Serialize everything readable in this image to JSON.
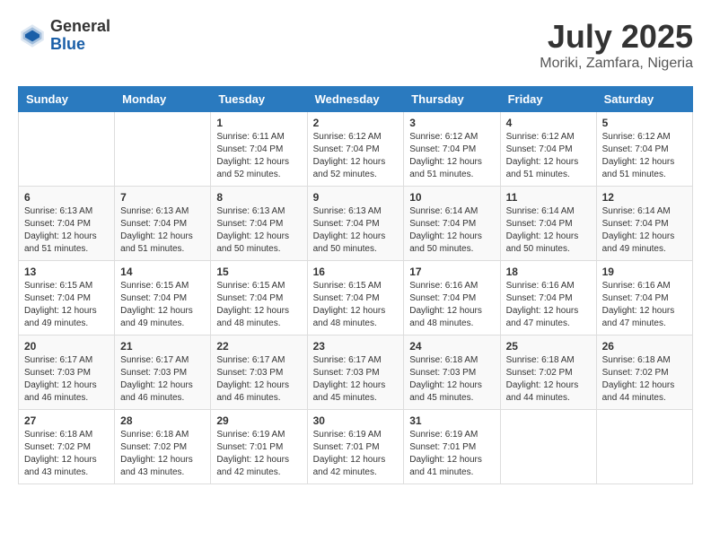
{
  "logo": {
    "general": "General",
    "blue": "Blue"
  },
  "title": {
    "month_year": "July 2025",
    "location": "Moriki, Zamfara, Nigeria"
  },
  "weekdays": [
    "Sunday",
    "Monday",
    "Tuesday",
    "Wednesday",
    "Thursday",
    "Friday",
    "Saturday"
  ],
  "weeks": [
    [
      {
        "day": "",
        "info": ""
      },
      {
        "day": "",
        "info": ""
      },
      {
        "day": "1",
        "info": "Sunrise: 6:11 AM\nSunset: 7:04 PM\nDaylight: 12 hours and 52 minutes."
      },
      {
        "day": "2",
        "info": "Sunrise: 6:12 AM\nSunset: 7:04 PM\nDaylight: 12 hours and 52 minutes."
      },
      {
        "day": "3",
        "info": "Sunrise: 6:12 AM\nSunset: 7:04 PM\nDaylight: 12 hours and 51 minutes."
      },
      {
        "day": "4",
        "info": "Sunrise: 6:12 AM\nSunset: 7:04 PM\nDaylight: 12 hours and 51 minutes."
      },
      {
        "day": "5",
        "info": "Sunrise: 6:12 AM\nSunset: 7:04 PM\nDaylight: 12 hours and 51 minutes."
      }
    ],
    [
      {
        "day": "6",
        "info": "Sunrise: 6:13 AM\nSunset: 7:04 PM\nDaylight: 12 hours and 51 minutes."
      },
      {
        "day": "7",
        "info": "Sunrise: 6:13 AM\nSunset: 7:04 PM\nDaylight: 12 hours and 51 minutes."
      },
      {
        "day": "8",
        "info": "Sunrise: 6:13 AM\nSunset: 7:04 PM\nDaylight: 12 hours and 50 minutes."
      },
      {
        "day": "9",
        "info": "Sunrise: 6:13 AM\nSunset: 7:04 PM\nDaylight: 12 hours and 50 minutes."
      },
      {
        "day": "10",
        "info": "Sunrise: 6:14 AM\nSunset: 7:04 PM\nDaylight: 12 hours and 50 minutes."
      },
      {
        "day": "11",
        "info": "Sunrise: 6:14 AM\nSunset: 7:04 PM\nDaylight: 12 hours and 50 minutes."
      },
      {
        "day": "12",
        "info": "Sunrise: 6:14 AM\nSunset: 7:04 PM\nDaylight: 12 hours and 49 minutes."
      }
    ],
    [
      {
        "day": "13",
        "info": "Sunrise: 6:15 AM\nSunset: 7:04 PM\nDaylight: 12 hours and 49 minutes."
      },
      {
        "day": "14",
        "info": "Sunrise: 6:15 AM\nSunset: 7:04 PM\nDaylight: 12 hours and 49 minutes."
      },
      {
        "day": "15",
        "info": "Sunrise: 6:15 AM\nSunset: 7:04 PM\nDaylight: 12 hours and 48 minutes."
      },
      {
        "day": "16",
        "info": "Sunrise: 6:15 AM\nSunset: 7:04 PM\nDaylight: 12 hours and 48 minutes."
      },
      {
        "day": "17",
        "info": "Sunrise: 6:16 AM\nSunset: 7:04 PM\nDaylight: 12 hours and 48 minutes."
      },
      {
        "day": "18",
        "info": "Sunrise: 6:16 AM\nSunset: 7:04 PM\nDaylight: 12 hours and 47 minutes."
      },
      {
        "day": "19",
        "info": "Sunrise: 6:16 AM\nSunset: 7:04 PM\nDaylight: 12 hours and 47 minutes."
      }
    ],
    [
      {
        "day": "20",
        "info": "Sunrise: 6:17 AM\nSunset: 7:03 PM\nDaylight: 12 hours and 46 minutes."
      },
      {
        "day": "21",
        "info": "Sunrise: 6:17 AM\nSunset: 7:03 PM\nDaylight: 12 hours and 46 minutes."
      },
      {
        "day": "22",
        "info": "Sunrise: 6:17 AM\nSunset: 7:03 PM\nDaylight: 12 hours and 46 minutes."
      },
      {
        "day": "23",
        "info": "Sunrise: 6:17 AM\nSunset: 7:03 PM\nDaylight: 12 hours and 45 minutes."
      },
      {
        "day": "24",
        "info": "Sunrise: 6:18 AM\nSunset: 7:03 PM\nDaylight: 12 hours and 45 minutes."
      },
      {
        "day": "25",
        "info": "Sunrise: 6:18 AM\nSunset: 7:02 PM\nDaylight: 12 hours and 44 minutes."
      },
      {
        "day": "26",
        "info": "Sunrise: 6:18 AM\nSunset: 7:02 PM\nDaylight: 12 hours and 44 minutes."
      }
    ],
    [
      {
        "day": "27",
        "info": "Sunrise: 6:18 AM\nSunset: 7:02 PM\nDaylight: 12 hours and 43 minutes."
      },
      {
        "day": "28",
        "info": "Sunrise: 6:18 AM\nSunset: 7:02 PM\nDaylight: 12 hours and 43 minutes."
      },
      {
        "day": "29",
        "info": "Sunrise: 6:19 AM\nSunset: 7:01 PM\nDaylight: 12 hours and 42 minutes."
      },
      {
        "day": "30",
        "info": "Sunrise: 6:19 AM\nSunset: 7:01 PM\nDaylight: 12 hours and 42 minutes."
      },
      {
        "day": "31",
        "info": "Sunrise: 6:19 AM\nSunset: 7:01 PM\nDaylight: 12 hours and 41 minutes."
      },
      {
        "day": "",
        "info": ""
      },
      {
        "day": "",
        "info": ""
      }
    ]
  ]
}
